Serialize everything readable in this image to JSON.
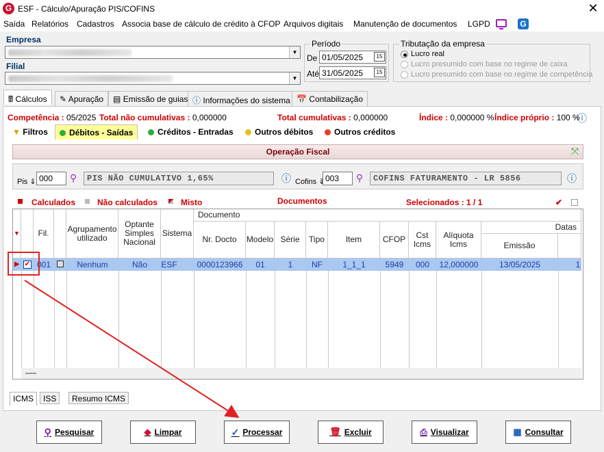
{
  "window": {
    "title": "ESF - Cálculo/Apuração PIS/COFINS",
    "app_icon_letter": "G"
  },
  "menu": [
    "Saída",
    "Relatórios",
    "Cadastros",
    "Associa base de cálculo de crédito à CFOP",
    "Arquivos digitais",
    "Manutenção de documentos",
    "LGPD"
  ],
  "empresa": {
    "label": "Empresa"
  },
  "filial": {
    "label": "Filial"
  },
  "periodo": {
    "title": "Período",
    "de_label": "De",
    "de_value": "01/05/2025",
    "ate_label": "Até",
    "ate_value": "31/05/2025",
    "cal_glyph": "15"
  },
  "tributacao": {
    "title": "Tributação da empresa",
    "options": [
      "Lucro real",
      "Lucro presumido com base no regime de caixa",
      "Lucro presumido com base no regime de competência"
    ]
  },
  "tabs": [
    "Cálculos",
    "Apuração",
    "Emissão de guias",
    "Informações do sistema",
    "Contabilização"
  ],
  "summary": {
    "competencia_label": "Competência :",
    "competencia_value": "05/2025",
    "nao_cum_label": "Total não cumulativas :",
    "nao_cum_value": "0,000000",
    "cum_label": "Total cumulativas :",
    "cum_value": "0,000000",
    "indice_label": "Índice :",
    "indice_value": "0,000000 %",
    "indice_proprio_label": "Índice próprio :",
    "indice_proprio_value": "100 %"
  },
  "subtabs": [
    "Filtros",
    "Débitos - Saídas",
    "Créditos - Entradas",
    "Outros débitos",
    "Outros créditos"
  ],
  "operacao": {
    "title": "Operação Fiscal",
    "pis_label": "Pis",
    "pis_code": "000",
    "pis_desc": "PIS NÃO CUMULATIVO 1,65%",
    "cofins_label": "Cofins",
    "cofins_code": "003",
    "cofins_desc": "COFINS FATURAMENTO - LR 5856"
  },
  "legend": {
    "calculados": "Calculados",
    "nao_calculados": "Não calculados",
    "misto": "Misto",
    "documentos": "Documentos",
    "selecionados": "Selecionados : 1 / 1"
  },
  "grid": {
    "group_documento": "Documento",
    "group_datas": "Datas",
    "headers": {
      "fil": "Fil.",
      "agrupamento": "Agrupamento utilizado",
      "optante": "Optante Simples Nacional",
      "sistema": "Sistema",
      "nr_docto": "Nr. Docto",
      "modelo": "Modelo",
      "serie": "Série",
      "tipo": "Tipo",
      "item": "Item",
      "cfop": "CFOP",
      "cst_icms": "Cst Icms",
      "aliquota": "Alíquota Icms",
      "emissao": "Emissão"
    },
    "rows": [
      {
        "fil": "001",
        "agrupamento": "Nenhum",
        "optante": "Não",
        "sistema": "ESF",
        "nr_docto": "0000123966",
        "modelo": "01",
        "serie": "1",
        "tipo": "NF",
        "item": "1_1_1",
        "cfop": "5949",
        "cst_icms": "000",
        "aliquota": "12,000000",
        "emissao": "13/05/2025",
        "extra": "1"
      }
    ]
  },
  "bottom_tabs": [
    "ICMS",
    "ISS",
    "Resumo ICMS"
  ],
  "buttons": [
    "Pesquisar",
    "Limpar",
    "Processar",
    "Excluir",
    "Visualizar",
    "Consultar"
  ],
  "colors": {
    "accent_red": "#cc0000",
    "selection_blue": "#aac8f0",
    "annotation_red": "#e02020"
  }
}
